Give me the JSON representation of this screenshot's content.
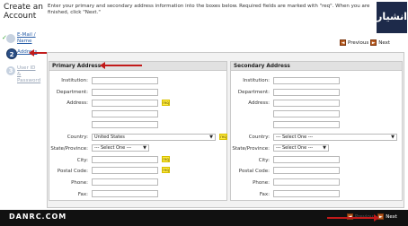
{
  "app": {
    "title": "Create an\nAccount"
  },
  "instruction": "Enter your primary and secondary address information into the boxes below. Required fields are marked with \"req\". When you are finished, click \"Next.\"",
  "watermark": "دانشیار",
  "steps": [
    {
      "number": "✓",
      "label": "E-Mail /\nName",
      "state": "complete"
    },
    {
      "number": "2",
      "label": "Address",
      "state": "current"
    },
    {
      "number": "3",
      "label": "User ID\n&\nPassword",
      "state": "pending"
    }
  ],
  "pager": {
    "previous_label": "Previous",
    "next_label": "Next",
    "prev_arrow": "◄",
    "next_arrow": "►"
  },
  "primary": {
    "title": "Primary Address",
    "institution_label": "Institution:",
    "department_label": "Department:",
    "address_label": "Address:",
    "country_label": "Country:",
    "country_value": "United States",
    "state_label": "State/Province:",
    "state_value": "--- Select One ---",
    "city_label": "City:",
    "postal_label": "Postal Code:",
    "phone_label": "Phone:",
    "fax_label": "Fax:",
    "req_text": "req"
  },
  "secondary": {
    "title": "Secondary Address",
    "institution_label": "Institution:",
    "department_label": "Department:",
    "address_label": "Address:",
    "country_label": "Country:",
    "country_value": "--- Select One ---",
    "state_label": "State/Province:",
    "state_value": "--- Select One ---",
    "city_label": "City:",
    "postal_label": "Postal Code:",
    "phone_label": "Phone:",
    "fax_label": "Fax:"
  },
  "footer": {
    "brand": "DANRC.COM"
  },
  "colors": {
    "accent_req": "#ffeb3b",
    "link": "#2a5fa8",
    "annotation": "#c21a1a"
  }
}
